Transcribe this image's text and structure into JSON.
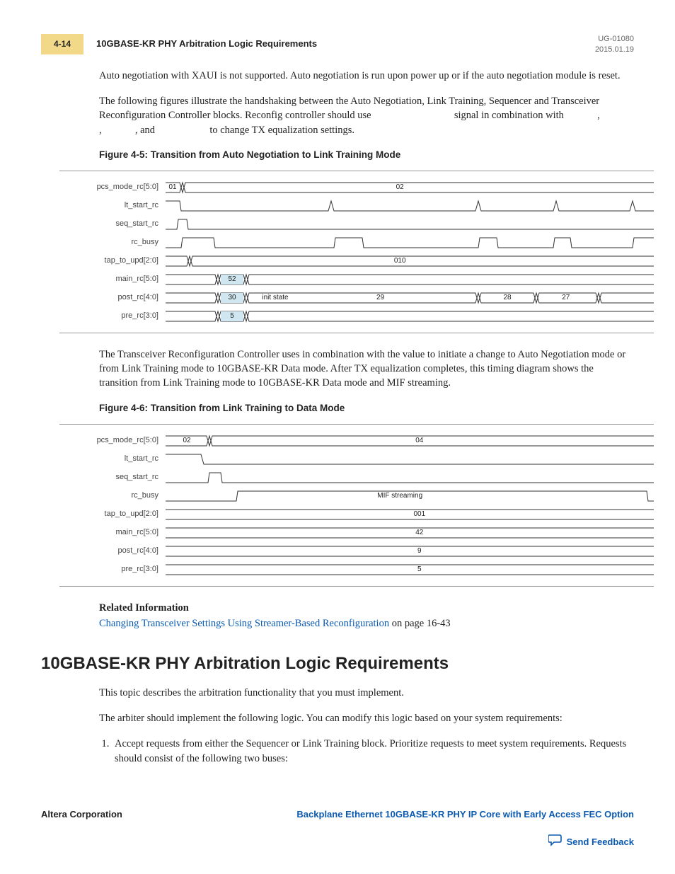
{
  "header": {
    "page_number": "4-14",
    "section_title": "10GBASE-KR PHY Arbitration Logic Requirements",
    "doc_id": "UG-01080",
    "date": "2015.01.19"
  },
  "para1": "Auto negotiation with XAUI is not supported. Auto negotiation is run upon power up or if the auto negotiation module is reset.",
  "para2a": "The following figures illustrate the handshaking between the Auto Negotiation, Link Training, Sequencer and Transceiver Reconfiguration Controller blocks. Reconfig controller should use ",
  "para2b": " signal in combination with ",
  "para2c": " , ",
  "para2d": " , ",
  "para2e": " , and ",
  "para2f": " to change TX equalization settings.",
  "figure1": {
    "caption": "Figure 4-5: Transition from Auto Negotiation to Link Training Mode"
  },
  "chart_data": [
    {
      "type": "timing",
      "title": "Transition from Auto Negotiation to Link Training Mode",
      "signals": [
        {
          "name": "pcs_mode_rc[5:0]",
          "segments": [
            "01",
            "02"
          ]
        },
        {
          "name": "lt_start_rc",
          "pulses": 4
        },
        {
          "name": "seq_start_rc",
          "pulse_at": "early"
        },
        {
          "name": "rc_busy",
          "pulses": 4
        },
        {
          "name": "tap_to_upd[2:0]",
          "values": [
            "010"
          ]
        },
        {
          "name": "main_rc[5:0]",
          "values": [
            "52"
          ]
        },
        {
          "name": "post_rc[4:0]",
          "values": [
            "30",
            "init state",
            "29",
            "28",
            "27"
          ]
        },
        {
          "name": "pre_rc[3:0]",
          "values": [
            "5"
          ]
        }
      ]
    },
    {
      "type": "timing",
      "title": "Transition from Link Training to Data Mode",
      "signals": [
        {
          "name": "pcs_mode_rc[5:0]",
          "segments": [
            "02",
            "04"
          ]
        },
        {
          "name": "lt_start_rc",
          "transition": "low"
        },
        {
          "name": "seq_start_rc",
          "pulse_at": "early"
        },
        {
          "name": "rc_busy",
          "annotation": "MIF streaming"
        },
        {
          "name": "tap_to_upd[2:0]",
          "values": [
            "001"
          ]
        },
        {
          "name": "main_rc[5:0]",
          "values": [
            "42"
          ]
        },
        {
          "name": "post_rc[4:0]",
          "values": [
            "9"
          ]
        },
        {
          "name": "pre_rc[3:0]",
          "values": [
            "5"
          ]
        }
      ]
    }
  ],
  "diagram1": {
    "labels": {
      "r0": "pcs_mode_rc[5:0]",
      "r1": "lt_start_rc",
      "r2": "seq_start_rc",
      "r3": "rc_busy",
      "r4": "tap_to_upd[2:0]",
      "r5": "main_rc[5:0]",
      "r6": "post_rc[4:0]",
      "r7": "pre_rc[3:0]"
    },
    "vals": {
      "v01": "01",
      "v02": "02",
      "v010": "010",
      "v52": "52",
      "v30": "30",
      "vinit": "init state",
      "v29": "29",
      "v28": "28",
      "v27": "27",
      "v5": "5"
    }
  },
  "para3": "The Transceiver Reconfiguration Controller uses                              in combination with the                  value to initiate a change to Auto Negotiation mode or from Link Training mode to 10GBASE-KR Data mode. After TX equalization completes, this timing diagram shows the transition from Link Training mode to 10GBASE-KR Data mode and MIF streaming.",
  "figure2": {
    "caption": "Figure 4-6: Transition from Link Training to Data Mode"
  },
  "diagram2": {
    "labels": {
      "r0": "pcs_mode_rc[5:0]",
      "r1": "lt_start_rc",
      "r2": "seq_start_rc",
      "r3": "rc_busy",
      "r4": "tap_to_upd[2:0]",
      "r5": "main_rc[5:0]",
      "r6": "post_rc[4:0]",
      "r7": "pre_rc[3:0]"
    },
    "vals": {
      "v02": "02",
      "v04": "04",
      "vmif": "MIF streaming",
      "v001": "001",
      "v42": "42",
      "v9": "9",
      "v5": "5"
    }
  },
  "related": {
    "heading": "Related Information",
    "link_text": "Changing Transceiver Settings Using Streamer-Based Reconfiguration",
    "tail": " on page 16-43"
  },
  "h1": "10GBASE-KR PHY Arbitration Logic Requirements",
  "para4": "This topic describes the arbitration functionality that you must implement.",
  "para5": "The arbiter should implement the following logic. You can modify this logic based on your system requirements:",
  "list": {
    "item1": "Accept requests from either the Sequencer or Link Training block. Prioritize requests to meet system requirements. Requests should consist of the following two buses:"
  },
  "footer": {
    "left": "Altera Corporation",
    "right": "Backplane Ethernet 10GBASE-KR PHY IP Core with Early Access FEC Option",
    "feedback": "Send Feedback"
  }
}
